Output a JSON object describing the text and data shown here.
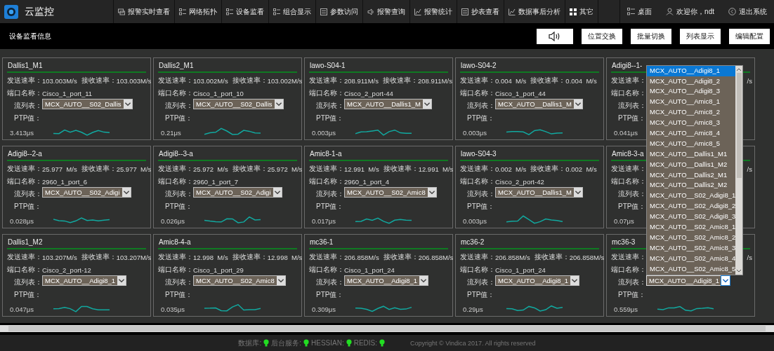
{
  "header": {
    "app_title": "云监控",
    "nav": [
      {
        "label": "报警实时查看"
      },
      {
        "label": "网络拓扑"
      },
      {
        "label": "设备监看"
      },
      {
        "label": "组合显示"
      },
      {
        "label": "参数访问"
      },
      {
        "label": "报警查询"
      },
      {
        "label": "报警统计"
      },
      {
        "label": "抄表查看"
      },
      {
        "label": "数据事后分析"
      },
      {
        "label": "其它"
      }
    ],
    "user_menu": [
      {
        "label": "桌面"
      },
      {
        "label": "欢迎你，ndt"
      },
      {
        "label": "退出系统"
      }
    ]
  },
  "toolbar": {
    "title": "设备监看信息",
    "buttons": [
      {
        "kind": "sound"
      },
      {
        "kind": "text",
        "label": "位置交换"
      },
      {
        "kind": "text",
        "label": "批量切换"
      },
      {
        "kind": "text",
        "label": "列表显示"
      },
      {
        "kind": "text",
        "label": "编辑配置"
      }
    ]
  },
  "cards": [
    {
      "title": "Dallis1_M1",
      "send_label": "发送速率：",
      "send": "103.003M/s",
      "recv_label": "接收速率：",
      "recv": "103.003M/s",
      "port_label": "端口名称：",
      "port": "Cisco_1_port_11",
      "stream_label": "流列表：",
      "stream": "MCX_AUTO__S02_Dallis",
      "open": false,
      "ptp_label": "PTP值：",
      "ptp": "3.413μs",
      "sparkline": true
    },
    {
      "title": "Dallis2_M1",
      "send_label": "发送速率：",
      "send": "103.002M/s",
      "recv_label": "接收速率：",
      "recv": "103.002M/s",
      "port_label": "端口名称：",
      "port": "Cisco_1_port_10",
      "stream_label": "流列表：",
      "stream": "MCX_AUTO__S02_Dallis",
      "open": false,
      "ptp_label": "PTP值：",
      "ptp": "0.21μs",
      "sparkline": true
    },
    {
      "title": "lawo-S04-1",
      "send_label": "发送速率：",
      "send": "208.911M/s",
      "recv_label": "接收速率：",
      "recv": "208.911M/s",
      "port_label": "端口名称：",
      "port": "Cisco_2_port-44",
      "stream_label": "流列表：",
      "stream": "MCX_AUTO__Dallis1_M",
      "open": false,
      "ptp_label": "PTP值：",
      "ptp": "0.003μs",
      "sparkline": true
    },
    {
      "title": "lawo-S04-2",
      "send_label": "发送速率：",
      "send": "0.004  M/s",
      "recv_label": "接收速率：",
      "recv": "0.004  M/s",
      "port_label": "端口名称：",
      "port": "Cisco_1_port_44",
      "stream_label": "流列表：",
      "stream": "MCX_AUTO__Dallis1_M",
      "open": false,
      "ptp_label": "PTP值：",
      "ptp": "0.003μs",
      "sparkline": true
    },
    {
      "title": "Adigi8--1-",
      "send_label": "发送速率：",
      "recv": "/s",
      "port_label": "端口名称：",
      "stream_label": "流列表：",
      "ptp_label": "PTP值：",
      "ptp": "0.041μs",
      "sparkline": false
    },
    {
      "title": "Adigi8--2-a",
      "send_label": "发送速率：",
      "send": "25.977  M/s",
      "recv_label": "接收速率：",
      "recv": "25.977  M/s",
      "port_label": "端口名称：",
      "port": "2960_1_port_6",
      "stream_label": "流列表：",
      "stream": "MCX_AUTO__S02_Adigi",
      "open": false,
      "ptp_label": "PTP值：",
      "ptp": "0.028μs",
      "sparkline": true
    },
    {
      "title": "Adigi8--3-a",
      "send_label": "发送速率：",
      "send": "25.972  M/s",
      "recv_label": "接收速率：",
      "recv": "25.972  M/s",
      "port_label": "端口名称：",
      "port": "2960_1_port_7",
      "stream_label": "流列表：",
      "stream": "MCX_AUTO__S02_Adigi",
      "open": false,
      "ptp_label": "PTP值：",
      "ptp": "0.026μs",
      "sparkline": true
    },
    {
      "title": "Amic8-1-a",
      "send_label": "发送速率：",
      "send": "12.991  M/s",
      "recv_label": "接收速率：",
      "recv": "12.991  M/s",
      "port_label": "端口名称：",
      "port": "2960_1_port_4",
      "stream_label": "流列表：",
      "stream": "MCX_AUTO__S02_Amic8",
      "open": false,
      "ptp_label": "PTP值：",
      "ptp": "0.017μs",
      "sparkline": true
    },
    {
      "title": "lawo-S04-3",
      "send_label": "发送速率：",
      "send": "0.002  M/s",
      "recv_label": "接收速率：",
      "recv": "0.002  M/s",
      "port_label": "端口名称：",
      "port": "Cisco_2_port-42",
      "stream_label": "流列表：",
      "stream": "MCX_AUTO__Dallis1_M",
      "open": false,
      "ptp_label": "PTP值：",
      "ptp": "0.003μs",
      "sparkline": true
    },
    {
      "title": "Amic8-3-a",
      "send_label": "发送速率：",
      "recv": "/s",
      "port_label": "端口名称：",
      "stream_label": "流列表：",
      "ptp_label": "PTP值：",
      "ptp": "0.07μs",
      "sparkline": false
    },
    {
      "title": "Dallis1_M2",
      "send_label": "发送速率：",
      "send": "103.207M/s",
      "recv_label": "接收速率：",
      "recv": "103.207M/s",
      "port_label": "端口名称：",
      "port": "Cisco_2_port-12",
      "stream_label": "流列表：",
      "stream": "MCX_AUTO__Adigi8_1",
      "open": false,
      "ptp_label": "PTP值：",
      "ptp": "0.047μs",
      "sparkline": true
    },
    {
      "title": "Amic8-4-a",
      "send_label": "发送速率：",
      "send": "12.998  M/s",
      "recv_label": "接收速率：",
      "recv": "12.998  M/s",
      "port_label": "端口名称：",
      "port": "Cisco_1_port_29",
      "stream_label": "流列表：",
      "stream": "MCX_AUTO__S02_Amic8",
      "open": false,
      "ptp_label": "PTP值：",
      "ptp": "0.035μs",
      "sparkline": true
    },
    {
      "title": "mc36-1",
      "send_label": "发送速率：",
      "send": "206.858M/s",
      "recv_label": "接收速率：",
      "recv": "206.858M/s",
      "port_label": "端口名称：",
      "port": "Cisco_1_port_24",
      "stream_label": "流列表：",
      "stream": "MCX_AUTO__Adigi8_1",
      "open": false,
      "ptp_label": "PTP值：",
      "ptp": "0.309μs",
      "sparkline": true
    },
    {
      "title": "mc36-2",
      "send_label": "发送速率：",
      "send": "206.858M/s",
      "recv_label": "接收速率：",
      "recv": "206.858M/s",
      "port_label": "端口名称：",
      "port": "Cisco_1_port_24",
      "stream_label": "流列表：",
      "stream": "MCX_AUTO__Adigi8_1",
      "open": false,
      "ptp_label": "PTP值：",
      "ptp": "0.29μs",
      "sparkline": true
    },
    {
      "title": "mc36-3",
      "send_label": "发送速率：",
      "recv": "/s",
      "port_label": "端口名称：",
      "stream_label": "流列表：",
      "stream": "MCX_AUTO__Adigi8_1",
      "open": true,
      "ptp_label": "PTP值：",
      "ptp": "0.559μs",
      "sparkline": true,
      "options": [
        {
          "label": "MCX_AUTO__Adigi8_1",
          "selected": true
        },
        {
          "label": "MCX_AUTO__Adigi8_2",
          "selected": false
        },
        {
          "label": "MCX_AUTO__Adigi8_3",
          "selected": false
        },
        {
          "label": "MCX_AUTO__Amic8_1",
          "selected": false
        },
        {
          "label": "MCX_AUTO__Amic8_2",
          "selected": false
        },
        {
          "label": "MCX_AUTO__Amic8_3",
          "selected": false
        },
        {
          "label": "MCX_AUTO__Amic8_4",
          "selected": false
        },
        {
          "label": "MCX_AUTO__Amic8_5",
          "selected": false
        },
        {
          "label": "MCX_AUTO__Dallis1_M1",
          "selected": false
        },
        {
          "label": "MCX_AUTO__Dallis1_M2",
          "selected": false
        },
        {
          "label": "MCX_AUTO__Dallis2_M1",
          "selected": false
        },
        {
          "label": "MCX_AUTO__Dallis2_M2",
          "selected": false
        },
        {
          "label": "MCX_AUTO__S02_Adigi8_1",
          "selected": false
        },
        {
          "label": "MCX_AUTO__S02_Adigi8_2",
          "selected": false
        },
        {
          "label": "MCX_AUTO__S02_Adigi8_3",
          "selected": false
        },
        {
          "label": "MCX_AUTO__S02_Amic8_1",
          "selected": false
        },
        {
          "label": "MCX_AUTO__S02_Amic8_2",
          "selected": false
        },
        {
          "label": "MCX_AUTO__S02_Amic8_3",
          "selected": false
        },
        {
          "label": "MCX_AUTO__S02_Amic8_4",
          "selected": false
        },
        {
          "label": "MCX_AUTO__S02_Amic8_5",
          "selected": false
        }
      ]
    }
  ],
  "footer": {
    "statuses": [
      {
        "label": "数据库:",
        "online": true
      },
      {
        "label": "后台服务:",
        "online": true
      },
      {
        "label": "HESSIAN:",
        "online": true
      },
      {
        "label": "REDIS:",
        "online": true
      }
    ],
    "copyright": "Copyright © Vindica 2017. All rights reserved"
  }
}
